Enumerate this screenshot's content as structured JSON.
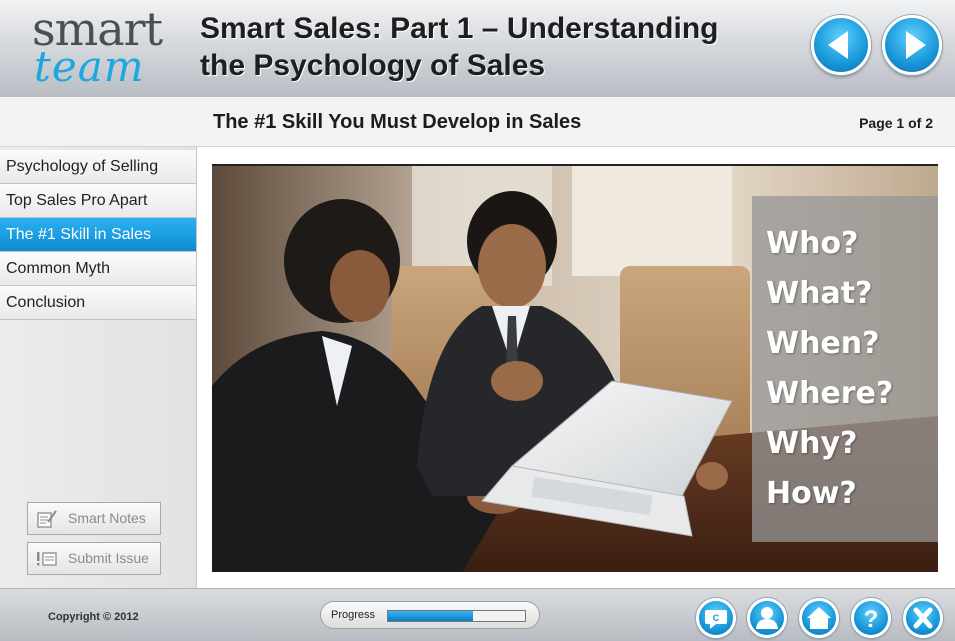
{
  "header": {
    "logo_line1": "smart",
    "logo_line2": "team",
    "course_title_line1": "Smart Sales: Part 1 – Understanding",
    "course_title_line2": "the Psychology of Sales",
    "back_icon": "triangle-left-icon",
    "next_icon": "triangle-right-icon"
  },
  "subheader": {
    "page_heading": "The #1 Skill You Must Develop in Sales",
    "page_count": "Page 1 of 2"
  },
  "sidebar": {
    "items": [
      {
        "label": "Psychology of Selling",
        "active": false
      },
      {
        "label": "Top Sales Pro Apart",
        "active": false
      },
      {
        "label": "The #1 Skill in Sales",
        "active": true
      },
      {
        "label": "Common Myth",
        "active": false
      },
      {
        "label": "Conclusion",
        "active": false
      }
    ],
    "smart_notes_label": "Smart Notes",
    "submit_issue_label": "Submit Issue",
    "active_color": "#1597dd"
  },
  "slide": {
    "questions": [
      "Who?",
      "What?",
      "When?",
      "Where?",
      "Why?",
      "How?"
    ]
  },
  "footer": {
    "copyright": "Copyright © 2012",
    "progress_label": "Progress",
    "progress_fraction": 0.62,
    "buttons": [
      "captions-icon",
      "profile-icon",
      "home-icon",
      "help-icon",
      "exit-icon"
    ]
  },
  "colors": {
    "accent": "#1ba7e0",
    "title_text": "#1c1e20"
  }
}
